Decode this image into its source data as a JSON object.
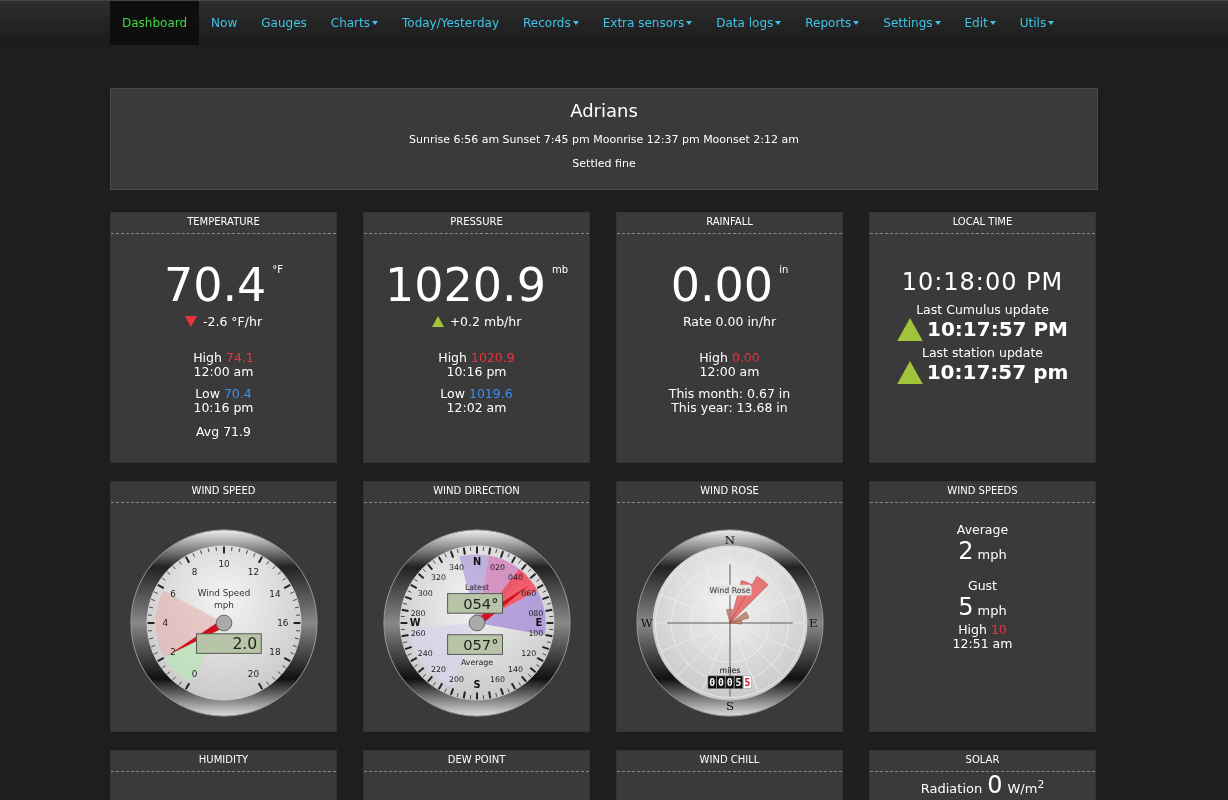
{
  "nav": [
    {
      "label": "Dashboard",
      "selected": true,
      "dropdown": false
    },
    {
      "label": "Now",
      "selected": false,
      "dropdown": false
    },
    {
      "label": "Gauges",
      "selected": false,
      "dropdown": false
    },
    {
      "label": "Charts",
      "selected": false,
      "dropdown": true
    },
    {
      "label": "Today/Yesterday",
      "selected": false,
      "dropdown": false
    },
    {
      "label": "Records",
      "selected": false,
      "dropdown": true
    },
    {
      "label": "Extra sensors",
      "selected": false,
      "dropdown": true
    },
    {
      "label": "Data logs",
      "selected": false,
      "dropdown": true
    },
    {
      "label": "Reports",
      "selected": false,
      "dropdown": true
    },
    {
      "label": "Settings",
      "selected": false,
      "dropdown": true
    },
    {
      "label": "Edit",
      "selected": false,
      "dropdown": true
    },
    {
      "label": "Utils",
      "selected": false,
      "dropdown": true
    }
  ],
  "header": {
    "title": "Adrians",
    "astro": "Sunrise 6:56 am Sunset 7:45 pm Moonrise 12:37 pm Moonset 2:12 am",
    "forecast": "Settled fine"
  },
  "cards": [
    {
      "kind": "reading",
      "title": "TEMPERATURE",
      "value": "70.4",
      "unit": "°F",
      "trend": {
        "kind": "down",
        "text": "-2.6 °F/hr"
      },
      "stats": [
        {
          "label": "High",
          "value": "74.1",
          "color": "#e8343f",
          "time": "12:00 am"
        },
        {
          "label": "Low",
          "value": "70.4",
          "color": "#3d8ff0",
          "time": "10:16 pm"
        },
        {
          "label": "Avg",
          "value": "71.9",
          "color": "#ffffff"
        }
      ]
    },
    {
      "kind": "reading",
      "title": "PRESSURE",
      "value": "1020.9",
      "unit": "mb",
      "trend": {
        "kind": "up",
        "text": "+0.2 mb/hr"
      },
      "stats": [
        {
          "label": "High",
          "value": "1020.9",
          "color": "#e8343f",
          "time": "10:16 pm"
        },
        {
          "label": "Low",
          "value": "1019.6",
          "color": "#3d8ff0",
          "time": "12:02 am"
        }
      ]
    },
    {
      "kind": "reading",
      "title": "RAINFALL",
      "value": "0.00",
      "unit": "in",
      "rate": "Rate 0.00 in/hr",
      "stats": [
        {
          "label": "High",
          "value": "0.00",
          "color": "#e8343f",
          "time": "12:00 am"
        }
      ],
      "notes": [
        "This month: 0.67 in",
        "This year: 13.68 in"
      ]
    },
    {
      "kind": "clock",
      "title": "LOCAL TIME",
      "time": "10:18:00 PM",
      "updates": [
        {
          "label": "Last Cumulus update",
          "time": "10:17:57 PM"
        },
        {
          "label": "Last station update",
          "time": "10:17:57 pm"
        }
      ]
    },
    {
      "kind": "speed_gauge",
      "title": "WIND SPEED",
      "dial_title": "Wind Speed",
      "unit": "mph",
      "scale": [
        "0",
        "2",
        "4",
        "6",
        "8",
        "10",
        "12",
        "14",
        "16",
        "18",
        "20"
      ],
      "reading": "2.0"
    },
    {
      "kind": "direction_gauge",
      "title": "WIND DIRECTION",
      "cardinals": [
        "N",
        "E",
        "S",
        "W"
      ],
      "degrees": [
        "020",
        "040",
        "060",
        "080",
        "100",
        "120",
        "140",
        "160",
        "200",
        "220",
        "240",
        "260",
        "280",
        "300",
        "320",
        "340"
      ],
      "latest_label": "Latest",
      "latest": "054°",
      "average_label": "Average",
      "average": "057°"
    },
    {
      "kind": "rose",
      "title": "WIND ROSE",
      "cardinals": [
        "N",
        "E",
        "S",
        "W"
      ],
      "dial_title": "Wind Rose",
      "odometer_label": "miles",
      "odometer": "00055"
    },
    {
      "kind": "wind_speeds",
      "title": "WIND SPEEDS",
      "speeds": [
        {
          "label": "Average",
          "value": "2",
          "unit": "mph"
        },
        {
          "label": "Gust",
          "value": "5",
          "unit": "mph"
        }
      ],
      "high": {
        "label": "High",
        "value": "10",
        "time": "12:51 am"
      }
    },
    {
      "kind": "empty",
      "title": "HUMIDITY"
    },
    {
      "kind": "empty",
      "title": "DEW POINT"
    },
    {
      "kind": "empty",
      "title": "WIND CHILL"
    },
    {
      "kind": "solar",
      "title": "SOLAR",
      "label": "Radiation",
      "value": "0",
      "unit": "W/m$^{2}$"
    }
  ]
}
